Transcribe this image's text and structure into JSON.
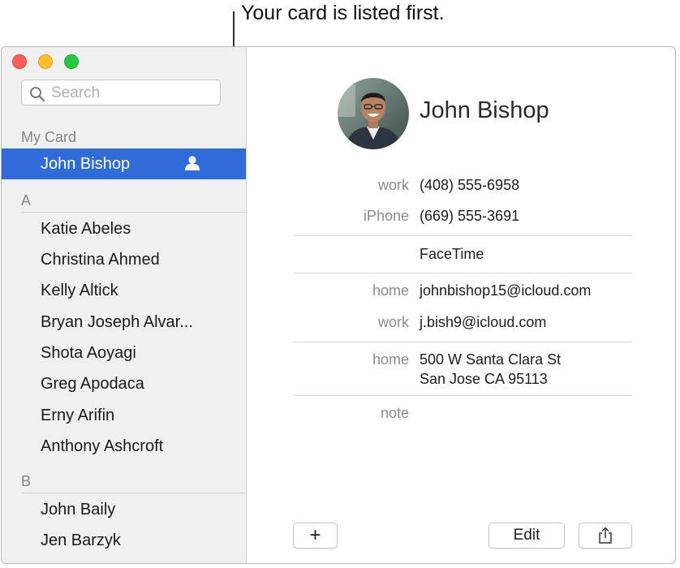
{
  "callout": {
    "text": "Your card is listed first."
  },
  "sidebar": {
    "search": {
      "placeholder": "Search"
    },
    "my_card_header": "My Card",
    "my_card_name": "John Bishop",
    "sections": [
      {
        "letter": "A",
        "contacts": [
          "Katie Abeles",
          "Christina Ahmed",
          "Kelly Altick",
          "Bryan Joseph Alvar...",
          "Shota Aoyagi",
          "Greg Apodaca",
          "Erny Arifin",
          "Anthony Ashcroft"
        ]
      },
      {
        "letter": "B",
        "contacts": [
          "John Baily",
          "Jen Barzyk"
        ]
      }
    ]
  },
  "detail": {
    "name": "John Bishop",
    "phones": [
      {
        "label": "work",
        "value": "(408) 555-6958"
      },
      {
        "label": "iPhone",
        "value": "(669) 555-3691"
      }
    ],
    "facetime": "FaceTime",
    "emails": [
      {
        "label": "home",
        "value": "johnbishop15@icloud.com"
      },
      {
        "label": "work",
        "value": "j.bish9@icloud.com"
      }
    ],
    "address": {
      "label": "home",
      "line1": "500 W Santa Clara St",
      "line2": "San Jose CA 95113"
    },
    "note_label": "note"
  },
  "toolbar": {
    "add_label": "+",
    "edit_label": "Edit"
  },
  "colors": {
    "selection": "#2f6bd9",
    "sidebar_bg": "#f0f0f0"
  }
}
